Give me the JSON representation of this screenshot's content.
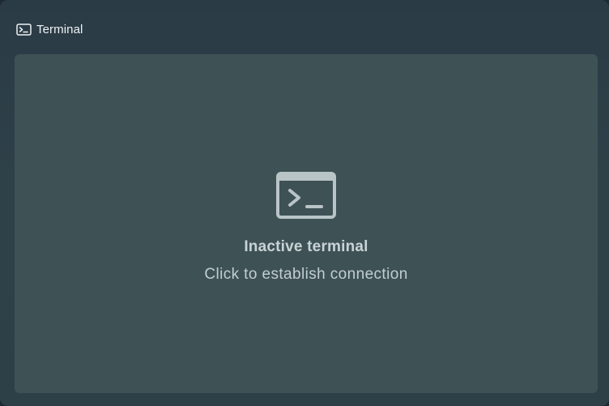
{
  "window": {
    "title": "Terminal",
    "title_icon": "terminal-icon"
  },
  "panel": {
    "icon": "terminal-icon",
    "status": "Inactive terminal",
    "hint": "Click to establish connection"
  },
  "colors": {
    "window_bg": "#2d3f47",
    "panel_bg": "#3e5256",
    "title_text": "#eef2f4",
    "icon": "#b9c4c7"
  }
}
